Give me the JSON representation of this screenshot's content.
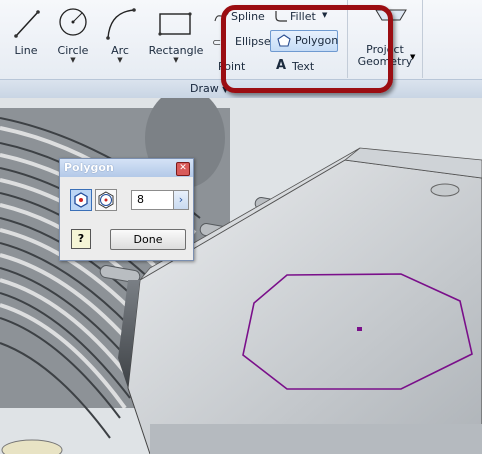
{
  "ribbon": {
    "line_label": "Line",
    "circle_label": "Circle",
    "arc_label": "Arc",
    "rectangle_label": "Rectangle",
    "spline_label": "Spline",
    "fillet_label": "Fillet",
    "ellipse_label": "Ellipse",
    "polygon_label": "Polygon",
    "point_label": "Point",
    "text_label": "Text",
    "project_geometry_label": "Project Geometry",
    "group_label": "Draw"
  },
  "dialog": {
    "title": "Polygon",
    "sides_value": "8",
    "done_label": "Done",
    "help_label": "?"
  },
  "colors": {
    "highlight": "#9b0d12",
    "sketch_polygon": "#7a0f8a"
  }
}
